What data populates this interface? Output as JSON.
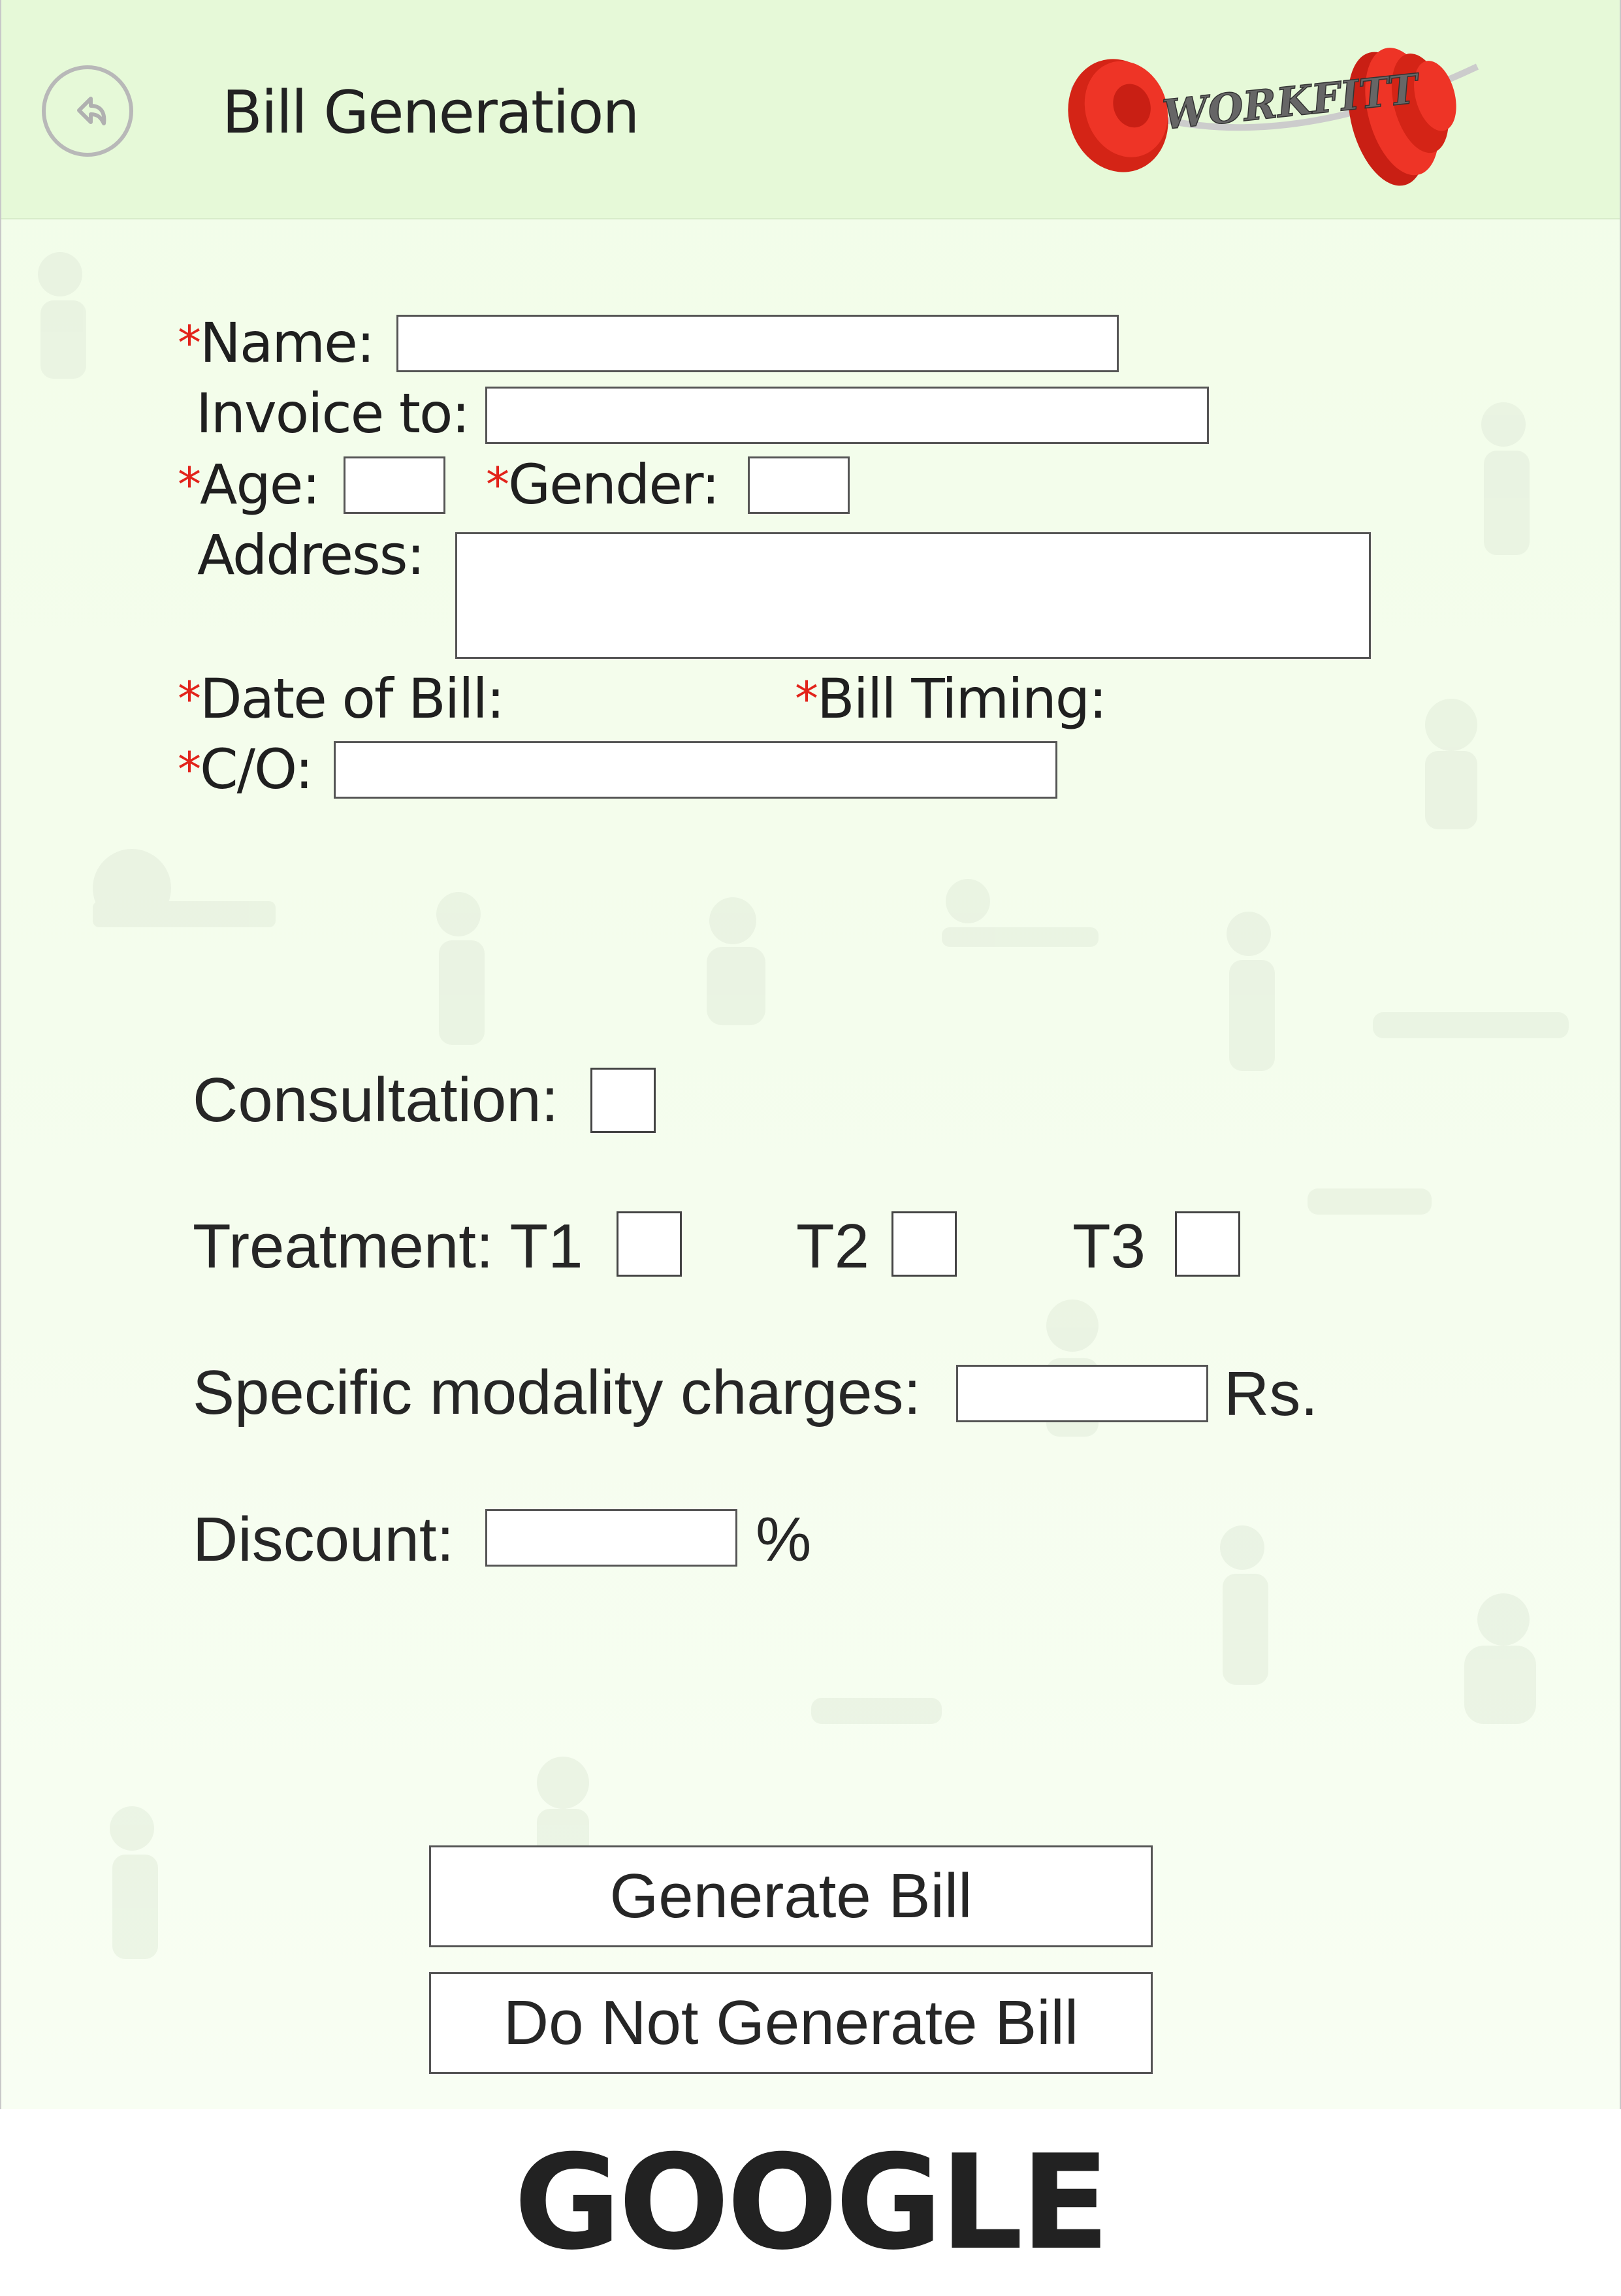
{
  "header": {
    "title": "Bill Generation",
    "logo_text": "WORKFITT"
  },
  "form": {
    "required_mark": "*",
    "name_label": "Name:",
    "invoice_label": "Invoice to:",
    "age_label": "Age:",
    "gender_label": "Gender:",
    "address_label": "Address:",
    "date_label": "Date of Bill:",
    "timing_label": "Bill Timing:",
    "co_label": "C/O:"
  },
  "charges": {
    "consultation_label": "Consultation:",
    "treatment_label": "Treatment: T1",
    "t2_label": "T2",
    "t3_label": "T3",
    "modality_label": "Specific modality charges:",
    "currency_label": "Rs.",
    "discount_label": "Discount:",
    "percent_label": "%"
  },
  "actions": {
    "generate_label": "Generate Bill",
    "do_not_generate_label": "Do Not Generate Bill"
  },
  "footer": {
    "brand": "GOOGLE"
  },
  "colors": {
    "header_bg": "#e6f9d8",
    "screen_bg": "#f2fde9",
    "required": "#e2231a",
    "logo_red": "#e2231a"
  }
}
